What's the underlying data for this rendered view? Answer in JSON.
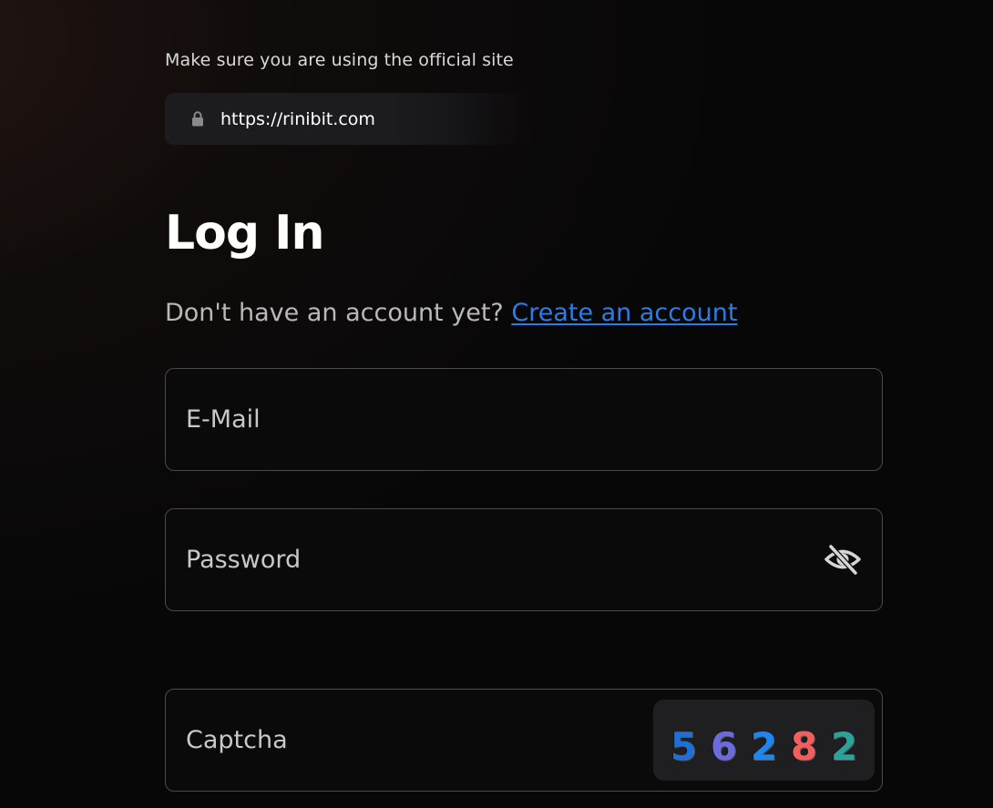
{
  "security_notice": {
    "text": "Make sure you are using the official site",
    "url": "https://rinibit.com",
    "icon": "lock-icon"
  },
  "login": {
    "title": "Log In",
    "signup_prompt": "Don't have an account yet?",
    "signup_link": "Create an account"
  },
  "form": {
    "email": {
      "placeholder": "E-Mail",
      "value": ""
    },
    "password": {
      "placeholder": "Password",
      "value": "",
      "toggle_icon": "eye-off-icon"
    },
    "captcha": {
      "placeholder": "Captcha",
      "value": "",
      "image_digits": [
        {
          "char": "5",
          "color": "#1f6fd6"
        },
        {
          "char": "6",
          "color": "#6b6be0"
        },
        {
          "char": "2",
          "color": "#1d86f0"
        },
        {
          "char": "8",
          "color": "#f25f5c"
        },
        {
          "char": "2",
          "color": "#2aa39a"
        }
      ]
    }
  },
  "colors": {
    "background": "#070708",
    "link": "#2f7be5",
    "field_border": "#4a4a4e"
  }
}
